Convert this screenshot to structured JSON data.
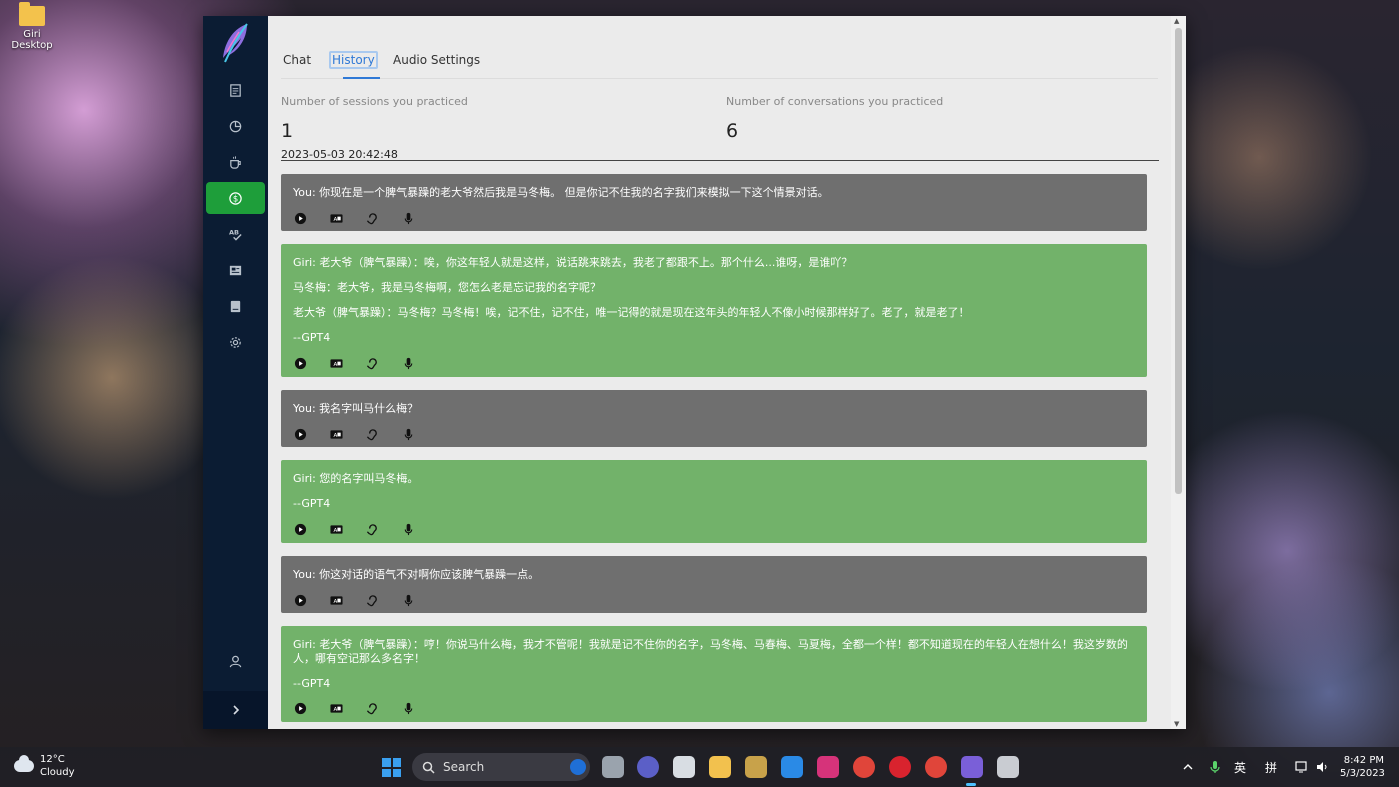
{
  "desktop": {
    "icon_label": "Giri Desktop"
  },
  "sidebar": {
    "items": [
      {
        "name": "notes-icon"
      },
      {
        "name": "pie-chart-icon"
      },
      {
        "name": "coffee-icon"
      },
      {
        "name": "dollar-icon",
        "active": true
      },
      {
        "name": "spellcheck-icon"
      },
      {
        "name": "newspaper-icon"
      },
      {
        "name": "book-icon"
      },
      {
        "name": "gear-icon"
      }
    ],
    "user_icon": "user-icon",
    "expand_icon": "chevron-right-icon"
  },
  "tabs": [
    {
      "label": "Chat"
    },
    {
      "label": "History",
      "active": true
    },
    {
      "label": "Audio Settings"
    }
  ],
  "stats": {
    "sessions_label": "Number of sessions you practiced",
    "sessions_value": "1",
    "conversations_label": "Number of conversations you practiced",
    "conversations_value": "6"
  },
  "session": {
    "date": "2023-05-03 20:42:48"
  },
  "messages": [
    {
      "role": "user",
      "lines": [
        "You: 你现在是一个脾气暴躁的老大爷然后我是马冬梅。 但是你记不住我的名字我们来模拟一下这个情景对话。"
      ]
    },
    {
      "role": "bot",
      "lines": [
        "Giri: 老大爷（脾气暴躁）：唉，你这年轻人就是这样，说话跳来跳去，我老了都跟不上。那个什么...谁呀，是谁吖？",
        "马冬梅：老大爷，我是马冬梅啊，您怎么老是忘记我的名字呢？",
        "老大爷（脾气暴躁）：马冬梅？马冬梅！唉，记不住，记不住，唯一记得的就是现在这年头的年轻人不像小时候那样好了。老了，就是老了！",
        "--GPT4"
      ]
    },
    {
      "role": "user",
      "lines": [
        "You: 我名字叫马什么梅？"
      ]
    },
    {
      "role": "bot",
      "lines": [
        "Giri: 您的名字叫马冬梅。",
        "--GPT4"
      ]
    },
    {
      "role": "user",
      "lines": [
        "You: 你这对话的语气不对啊你应该脾气暴躁一点。"
      ]
    },
    {
      "role": "bot",
      "lines": [
        "Giri: 老大爷（脾气暴躁）：哼！你说马什么梅，我才不管呢！我就是记不住你的名字，马冬梅、马春梅、马夏梅，全都一个样！都不知道现在的年轻人在想什么！我这岁数的人，哪有空记那么多名字！",
        "--GPT4"
      ]
    }
  ],
  "message_actions": [
    "play-icon",
    "translate-icon",
    "listen-icon",
    "microphone-icon"
  ],
  "taskbar": {
    "temperature": "12°C",
    "weather": "Cloudy",
    "search_placeholder": "Search",
    "ime_lang": "英",
    "ime_mode": "拼",
    "time": "8:42 PM",
    "date": "5/3/2023"
  },
  "colors": {
    "sidebar": "#0b1c33",
    "active_nav": "#1e9e3a",
    "user_bubble": "#6f6f6f",
    "bot_bubble": "#72b26a",
    "accent": "#2f79d6"
  }
}
